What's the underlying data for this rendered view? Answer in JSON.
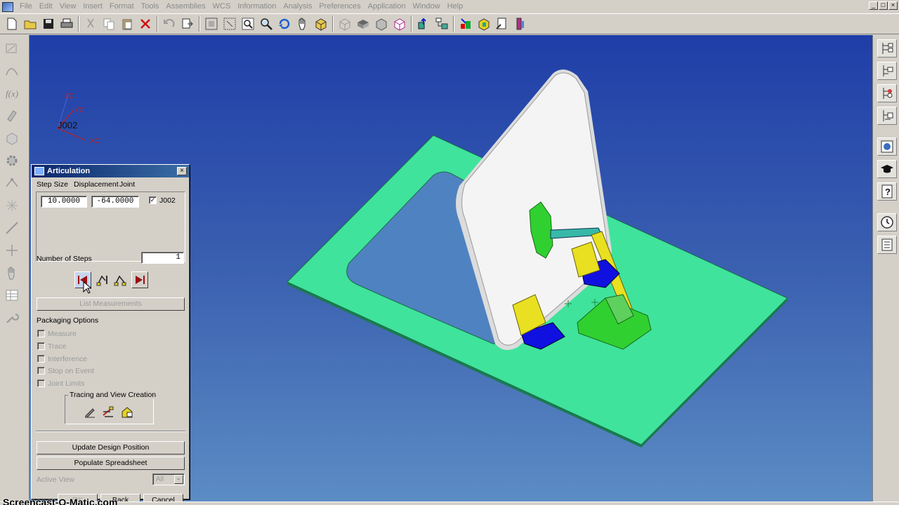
{
  "menubar": {
    "items": [
      "File",
      "Edit",
      "View",
      "Insert",
      "Format",
      "Tools",
      "Assemblies",
      "WCS",
      "Information",
      "Analysis",
      "Preferences",
      "Application",
      "Window",
      "Help"
    ]
  },
  "window_controls": {
    "minimize": "_",
    "maximize": "□",
    "close": "×"
  },
  "viewport": {
    "triad": {
      "zc": "ZC",
      "yc": "YC",
      "xc": "XC",
      "joint": "J002"
    },
    "colors": {
      "base_plate": "#3fe39c",
      "door_panel": "#f4f4f4",
      "hinge_yellow": "#e8e020",
      "bracket_blue": "#1010e0",
      "bracket_green": "#30d030",
      "background_top": "#1f3ea8",
      "background_bottom": "#5c8cc4"
    }
  },
  "dialog": {
    "title": "Articulation",
    "close_glyph": "×",
    "columns": {
      "step_size": "Step Size",
      "displacement": "Displacement",
      "joint": "Joint"
    },
    "step_size_value": "10.0000",
    "displacement_value": "-64.0000",
    "joint_checked": "✓",
    "joint_name": "J002",
    "number_of_steps_label": "Number of Steps",
    "number_of_steps_value": "1",
    "list_measurements": "List Measurements",
    "packaging_options_label": "Packaging Options",
    "packaging_options": [
      "Measure",
      "Trace",
      "Interference",
      "Stop on Event",
      "Joint Limits"
    ],
    "tracing_label": "Tracing and View Creation",
    "update_design_position": "Update Design Position",
    "populate_spreadsheet": "Populate Spreadsheet",
    "active_view_label": "Active View",
    "active_view_value": "All",
    "ok": "OK",
    "back": "Back",
    "cancel": "Cancel"
  },
  "watermark": "Screencast-O-Matic.com"
}
